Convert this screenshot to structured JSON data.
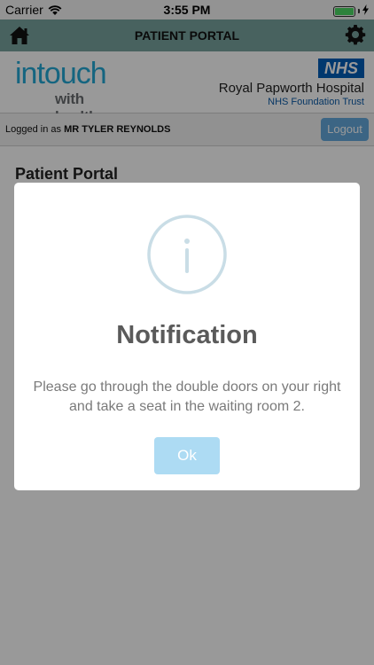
{
  "status_bar": {
    "carrier": "Carrier",
    "time": "3:55 PM",
    "battery_level": 1.0
  },
  "header": {
    "title": "PATIENT PORTAL",
    "home_icon": "home-icon",
    "settings_icon": "gear-icon"
  },
  "brand": {
    "logo_main": "intouch",
    "logo_sub": "with health",
    "nhs_badge": "NHS",
    "hospital_name": "Royal Papworth Hospital",
    "trust_name": "NHS Foundation Trust"
  },
  "session": {
    "logged_in_prefix": "Logged in as",
    "user_name": "MR TYLER REYNOLDS",
    "logout_label": "Logout"
  },
  "page": {
    "title": "Patient Portal"
  },
  "modal": {
    "icon": "info-icon",
    "title": "Notification",
    "message": "Please go through the double doors on your right and take a seat in the waiting room 2.",
    "ok_label": "Ok"
  },
  "colors": {
    "header_bg": "#79a39e",
    "logo_blue": "#24a9d5",
    "nhs_blue": "#005eb8",
    "logout_bg": "#65a9dc",
    "ok_bg": "#addbf3",
    "info_ring": "#c9dde6"
  }
}
